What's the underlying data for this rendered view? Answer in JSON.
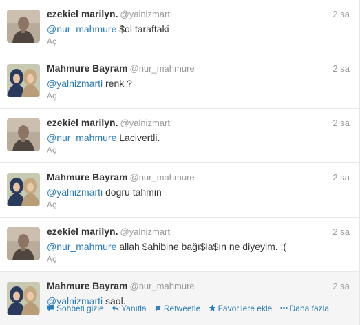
{
  "tweets": [
    {
      "fullname": "ezekiel marilyn.",
      "username": "@yalnizmarti",
      "time": "2 sa",
      "mention": "@nur_mahmure",
      "rest": " $ol taraftaki",
      "expand_label": "Aç",
      "avatar": "man-avatar"
    },
    {
      "fullname": "Mahmure Bayram",
      "username": "@nur_mahmure",
      "time": "2 sa",
      "mention": "@yalnizmarti",
      "rest": " renk ?",
      "expand_label": "Aç",
      "avatar": "two-women-avatar"
    },
    {
      "fullname": "ezekiel marilyn.",
      "username": "@yalnizmarti",
      "time": "2 sa",
      "mention": "@nur_mahmure",
      "rest": " Lacivertli.",
      "expand_label": "Aç",
      "avatar": "man-avatar"
    },
    {
      "fullname": "Mahmure Bayram",
      "username": "@nur_mahmure",
      "time": "2 sa",
      "mention": "@yalnizmarti",
      "rest": " dogru tahmin",
      "expand_label": "Aç",
      "avatar": "two-women-avatar"
    },
    {
      "fullname": "ezekiel marilyn.",
      "username": "@yalnizmarti",
      "time": "2 sa",
      "mention": "@nur_mahmure",
      "rest": " allah $ahibine bağı$la$ın ne diyeyim. :(",
      "expand_label": "Aç",
      "avatar": "man-avatar"
    },
    {
      "fullname": "Mahmure Bayram",
      "username": "@nur_mahmure",
      "time": "2 sa",
      "mention": "@yalnizmarti",
      "rest": " saol.",
      "avatar": "two-women-avatar",
      "actions": {
        "conversation": "Sohbeti gizle",
        "reply": "Yanıtla",
        "retweet": "Retweetle",
        "favorite": "Favorilere ekle",
        "more": "Daha fazla"
      }
    }
  ],
  "colors": {
    "link": "#2b7bb9",
    "muted": "#999999",
    "text": "#333333",
    "hover_background": "#f5f5f5"
  }
}
